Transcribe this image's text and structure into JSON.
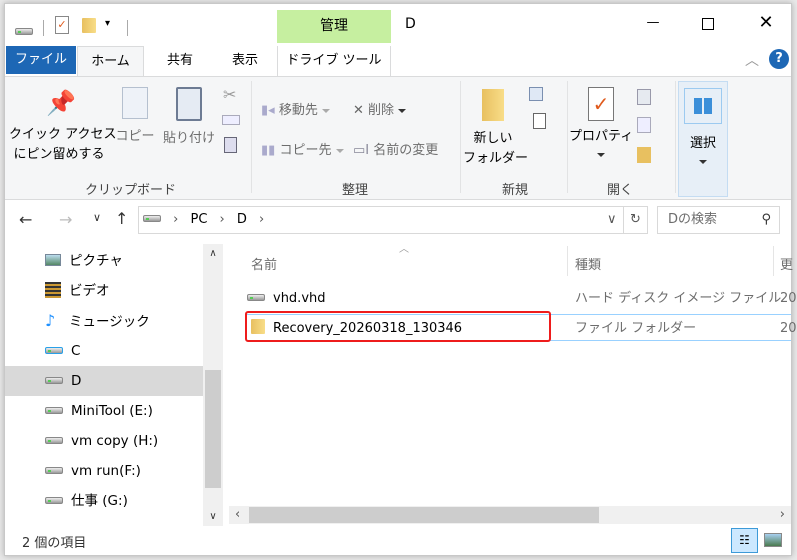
{
  "window": {
    "title": "D",
    "context_tab_group": "管理",
    "context_tab": "ドライブ ツール"
  },
  "tabs": [
    "ファイル",
    "ホーム",
    "共有",
    "表示"
  ],
  "ribbon": {
    "clipboard": {
      "label": "クリップボード",
      "pin_line1": "クイック アクセス",
      "pin_line2": "にピン留めする",
      "copy": "コピー",
      "paste": "貼り付け"
    },
    "organize": {
      "label": "整理",
      "move_to": "移動先",
      "delete": "削除",
      "copy_to": "コピー先",
      "rename": "名前の変更"
    },
    "new": {
      "label": "新規",
      "new_folder_line1": "新しい",
      "new_folder_line2": "フォルダー"
    },
    "open": {
      "label": "開く",
      "properties": "プロパティ"
    },
    "select": {
      "label": "選択"
    }
  },
  "address": {
    "path": [
      "PC",
      "D"
    ],
    "search_placeholder": "Dの検索"
  },
  "nav_pane": {
    "items": [
      {
        "label": "ピクチャ",
        "icon": "pictures-icon"
      },
      {
        "label": "ビデオ",
        "icon": "video-icon"
      },
      {
        "label": "ミュージック",
        "icon": "music-icon"
      },
      {
        "label": "C",
        "icon": "windows-drive-icon"
      },
      {
        "label": "D",
        "icon": "drive-icon",
        "selected": true
      },
      {
        "label": "MiniTool (E:)",
        "icon": "drive-icon"
      },
      {
        "label": "vm copy (H:)",
        "icon": "drive-icon"
      },
      {
        "label": "vm run(F:)",
        "icon": "drive-icon"
      },
      {
        "label": "仕事 (G:)",
        "icon": "drive-icon"
      }
    ]
  },
  "content": {
    "columns": [
      "名前",
      "種類",
      "更"
    ],
    "rows": [
      {
        "name": "vhd.vhd",
        "type": "ハード ディスク イメージ ファイル",
        "date": "20"
      },
      {
        "name": "Recovery_20260318_130346",
        "type": "ファイル フォルダー",
        "date": "20",
        "highlighted": true
      }
    ]
  },
  "status": {
    "count": "2 個の項目"
  },
  "colors": {
    "file_tab": "#1d67b5",
    "manage_tab": "#c6efa0",
    "highlight_box": "#ee1c1c"
  }
}
